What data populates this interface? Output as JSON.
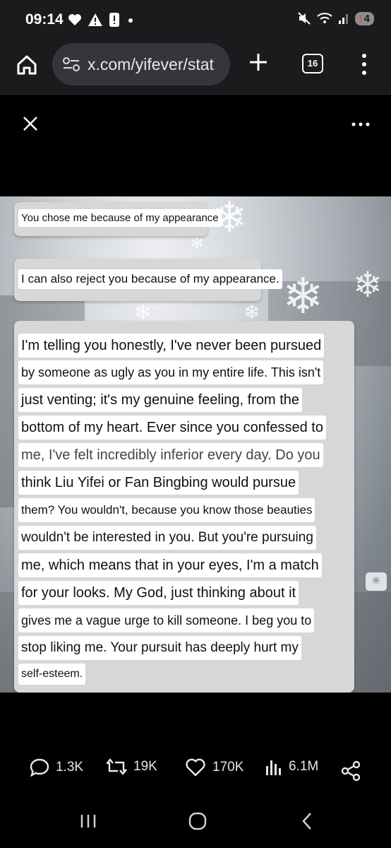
{
  "status_bar": {
    "time": "09:14",
    "battery": "4",
    "battery_alert": "!"
  },
  "browser": {
    "url": "x.com/yifever/stat",
    "tab_count": "16"
  },
  "post_image": {
    "messages": [
      {
        "lines": [
          "You chose me because of my appearance"
        ]
      },
      {
        "lines": [
          "I can also reject you because of my appearance."
        ]
      },
      {
        "lines": [
          "I'm telling you honestly, I've never been pursued",
          "by someone as ugly as you in my entire life. This isn't",
          "just venting; it's my genuine feeling, from the",
          "bottom of my heart. Ever since you confessed to",
          "me, I've felt incredibly inferior every day. Do you",
          "think Liu Yifei or Fan Bingbing would pursue",
          "them? You wouldn't, because you know those beauties",
          "wouldn't be interested in you. But you're pursuing",
          "me, which means that in your eyes, I'm a match",
          "for your looks. My God, just thinking about it",
          "gives me a vague urge to kill someone. I beg you to",
          "stop liking me. Your pursuit has deeply hurt my",
          "self-esteem."
        ]
      }
    ]
  },
  "actions": {
    "replies": "1.3K",
    "reposts": "19K",
    "likes": "170K",
    "views": "6.1M"
  },
  "icons": [
    "home-icon",
    "tune-icon",
    "plus-icon",
    "tabs-icon",
    "menu-icon",
    "close-icon",
    "more-icon",
    "reply-icon",
    "repost-icon",
    "like-icon",
    "views-icon",
    "share-icon"
  ]
}
